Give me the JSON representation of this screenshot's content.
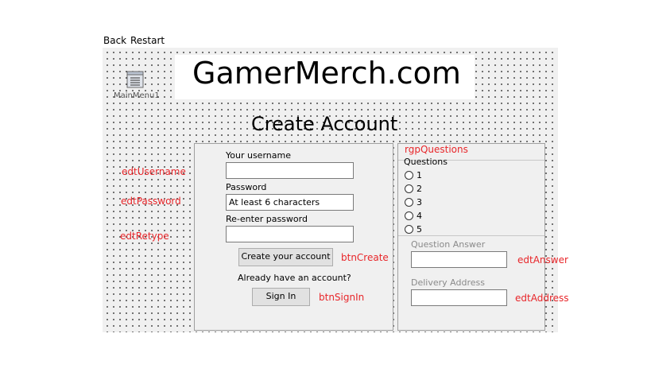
{
  "top_menu": {
    "back": "Back",
    "restart": "Restart"
  },
  "banner": {
    "text": "GamerMerch.com"
  },
  "main_menu_component": {
    "label": "MainMenu1",
    "icon": "menu-icon"
  },
  "page_title": "Create Account",
  "left_panel": {
    "username_label": "Your username",
    "username_value": "",
    "password_label": "Password",
    "password_value": "At least 6 characters",
    "retype_label": "Re-enter password",
    "retype_value": "",
    "create_button": "Create your account",
    "already_text": "Already have an account?",
    "signin_button": "Sign In"
  },
  "right_panel": {
    "questions_caption": "Questions",
    "radio_options": [
      "1",
      "2",
      "3",
      "4",
      "5"
    ],
    "answer_label": "Question Answer",
    "answer_value": "",
    "address_label": "Delivery Address",
    "address_value": ""
  },
  "component_names": {
    "edtUsername": "edtUsername",
    "edtPassword": "edtPassword",
    "edtRetype": "edtRetype",
    "btnCreate": "btnCreate",
    "btnSignIn": "btnSignIn",
    "rgpQuestions": "rgpQuestions",
    "edtAnswer": "edtAnswer",
    "edtAddress": "edtAddress"
  },
  "colors": {
    "annotation": "#e8262a",
    "form_bg": "#f0f0f0"
  }
}
